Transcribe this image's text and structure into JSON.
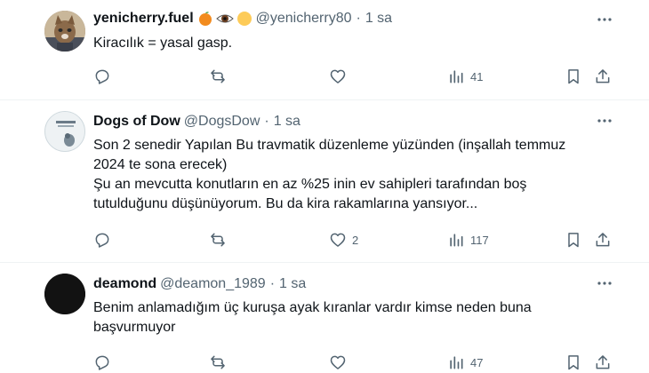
{
  "colors": {
    "text": "#0f1419",
    "secondary": "#536471",
    "divider": "#eff3f4"
  },
  "tweets": [
    {
      "name": "yenicherry.fuel",
      "badges": [
        "orange-emoji",
        "eye-emoji",
        "yellow-circle-emoji"
      ],
      "handle": "@yenicherry80",
      "dot": "·",
      "time": "1 sa",
      "text": "Kiracılık = yasal gasp.",
      "replies": "",
      "retweets": "",
      "likes": "",
      "views": "41"
    },
    {
      "name": "Dogs of Dow",
      "handle": "@DogsDow",
      "dot": "·",
      "time": "1 sa",
      "text": "Son 2 senedir Yapılan Bu travmatik düzenleme yüzünden (inşallah temmuz\n2024 te sona erecek)\nŞu an mevcutta konutların en az %25 inin ev sahipleri tarafından boş\ntutulduğunu düşünüyorum. Bu da kira rakamlarına yansıyor...",
      "replies": "",
      "retweets": "",
      "likes": "2",
      "views": "117"
    },
    {
      "name": "deamond",
      "handle": "@deamon_1989",
      "dot": "·",
      "time": "1 sa",
      "text": "Benim anlamadığım üç kuruşa ayak kıranlar vardır kimse neden buna\nbaşvurmuyor",
      "replies": "",
      "retweets": "",
      "likes": "",
      "views": "47"
    }
  ]
}
